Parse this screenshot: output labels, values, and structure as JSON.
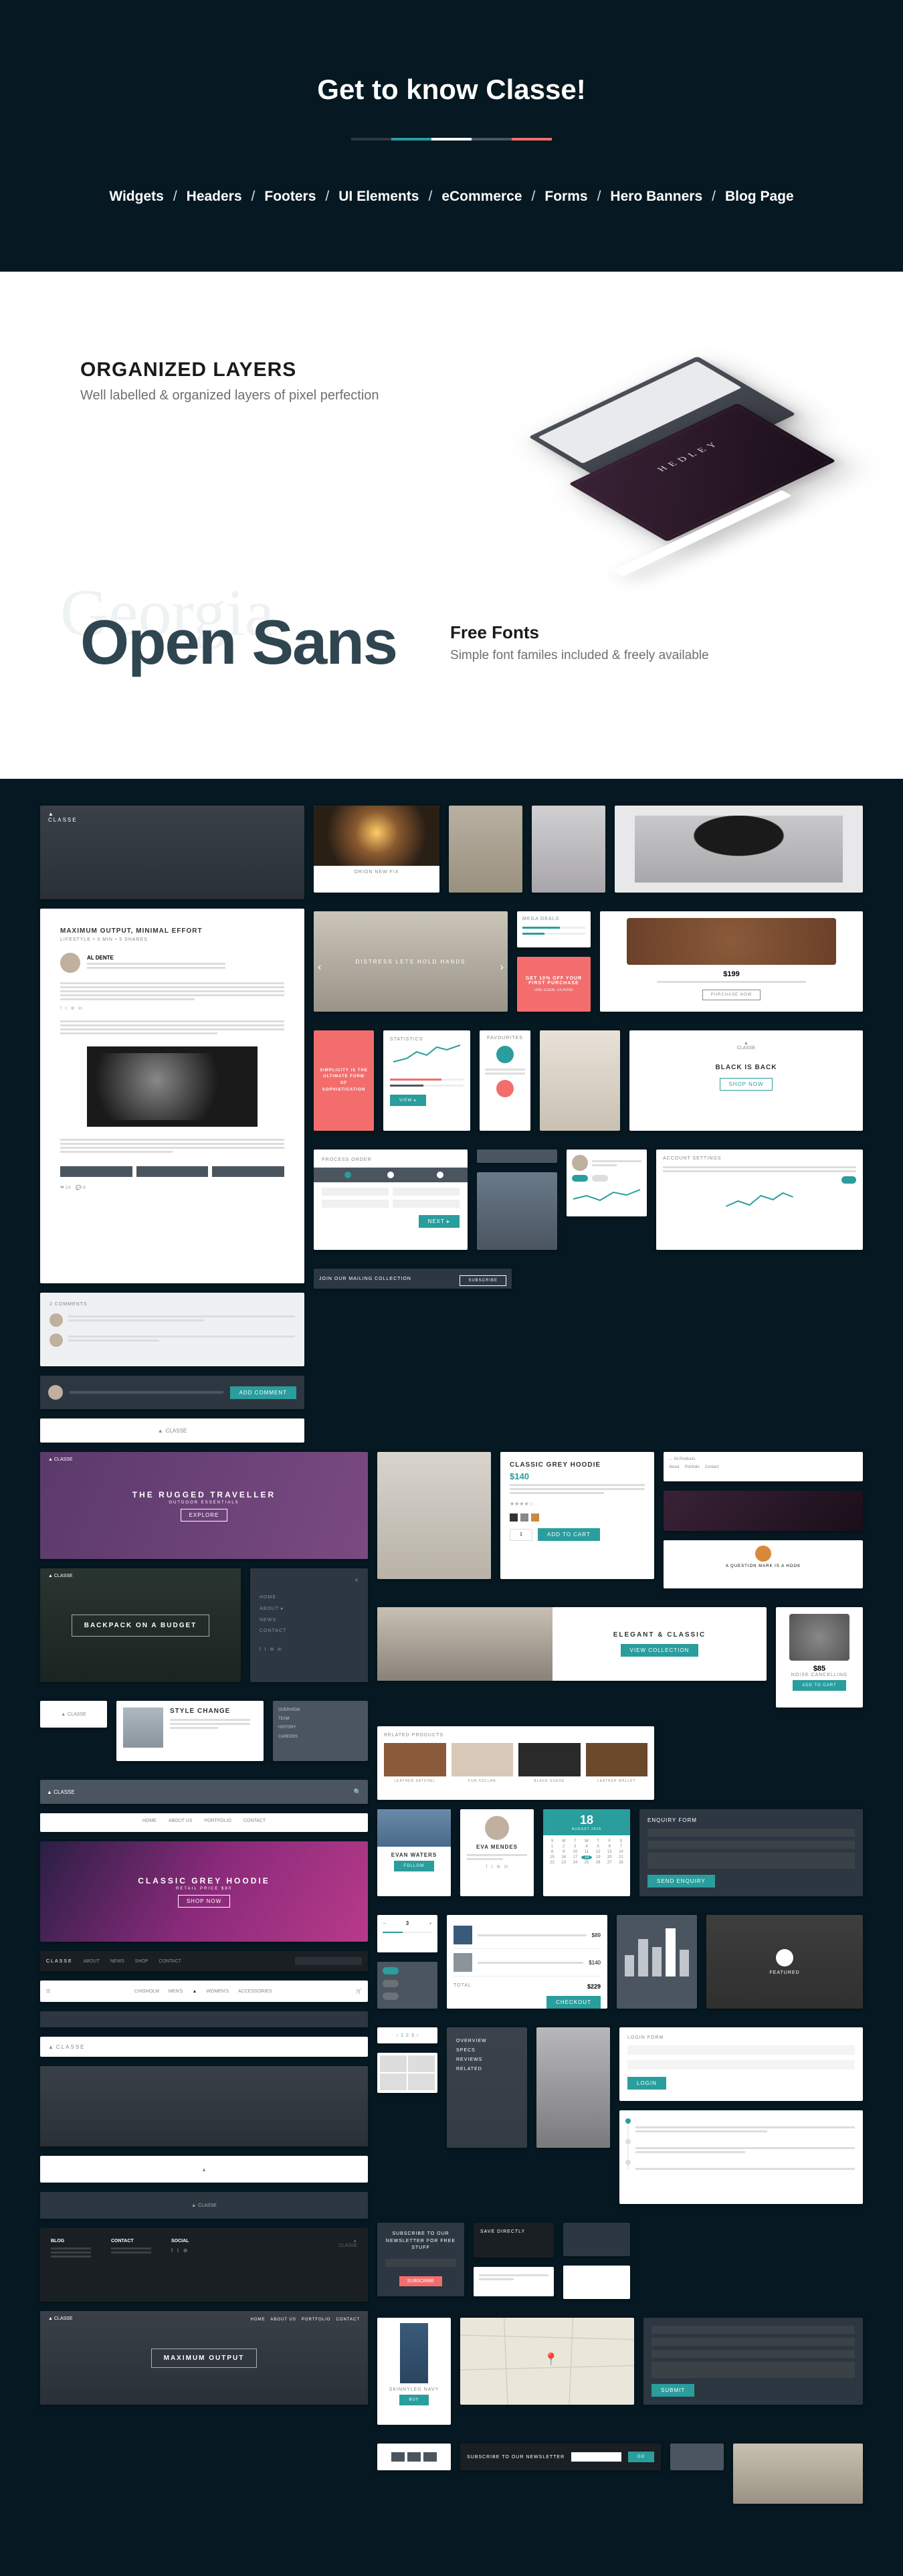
{
  "hero": {
    "title": "Get to know Classe!",
    "divider_colors": [
      "#2d3742",
      "#2a9d9d",
      "#ffffff",
      "#4a5560",
      "#f36d6d"
    ],
    "nav": [
      "Widgets",
      "Headers",
      "Footers",
      "UI Elements",
      "eCommerce",
      "Forms",
      "Hero Banners",
      "Blog Page"
    ]
  },
  "organized": {
    "heading": "ORGANIZED LAYERS",
    "sub": "Well labelled & organized layers of pixel perfection",
    "mock_label": "HEDLEY"
  },
  "fonts": {
    "bg_word": "Georgia",
    "fg_word": "Open Sans",
    "heading": "Free Fonts",
    "sub": "Simple font familes included & freely available"
  },
  "gallery": {
    "brand": "CLASSE",
    "article": {
      "title": "MAXIMUM OUTPUT, MINIMAL EFFORT",
      "author": "AL DENTE",
      "cta": "ADD COMMENT"
    },
    "cards_top": {
      "sparkler": "ORION NEW FIX",
      "promo": "GET 10% OFF YOUR FIRST PURCHASE",
      "promo_code": "USE CODE: CLASSE",
      "bag_price": "$199",
      "bag_cta": "PURCHASE NOW",
      "umbrella": "DISTRESS LETS HOLD HANDS",
      "red_quote": "SIMPLICITY IS THE ULTIMATE FORM OF SOPHISTICATION",
      "black_back": "BLACK IS BACK",
      "shop_now": "SHOP NOW",
      "account_settings": "ACCOUNT SETTINGS",
      "process_order": "PROCESS ORDER",
      "join": "JOIN OUR MAILING COLLECTION",
      "favourites": "FAVOURITES"
    },
    "heroes": {
      "rugged": "THE RUGGED TRAVELLER",
      "rugged_sub": "OUTDOOR ESSENTIALS",
      "backpack": "BACKPACK ON A BUDGET",
      "style": "STYLE CHANGE",
      "hoodie": "CLASSIC GREY HOODIE",
      "hoodie_sub": "RETAIL PRICE $80",
      "maxout": "MAXIMUM OUTPUT"
    },
    "product": {
      "title": "CLASSIC GREY HOODIE",
      "price": "$140",
      "cta": "ADD TO CART",
      "elegant": "ELEGANT & CLASSIC",
      "related": "RELATED PRODUCTS",
      "rel_items": [
        "LEATHER SATCHEL",
        "FUR COLLAR",
        "BLACK SUEDE",
        "LEATHER WALLET"
      ],
      "headphone_price": "$85",
      "jeans": "SKINNYLEG NAVY"
    },
    "forms": {
      "enquiry": "ENQUIRY FORM",
      "send": "SEND ENQUIRY",
      "login": "LOGIN FORM",
      "newsletter": "SUBSCRIBE TO OUR NEWSLETTER FOR FREE STUFF",
      "subscribe": "SUBSCRIBE",
      "newsletter2": "SUBSCRIBE TO OUR NEWSLETTER"
    },
    "nav_footer": {
      "items": [
        "HOME",
        "ABOUT US",
        "PORTFOLIO",
        "CONTACT"
      ],
      "items2": [
        "ABOUT",
        "NEWS",
        "SHOP",
        "CONTACT"
      ],
      "items3": [
        "CHISHOLM",
        "MEN'S",
        "WOMEN'S",
        "ACCESSORIES"
      ],
      "footer_cols": [
        "BLOG",
        "CONTACT",
        "SOCIAL"
      ],
      "calendar_day": "18",
      "calendar_month": "AUGUST 2016",
      "profile": "EVA MENDES",
      "follow": "FOLLOW",
      "pumpkin": "A QUESTION MARK IS A HOOK",
      "directory": "SAVE DIRECTLY"
    }
  }
}
